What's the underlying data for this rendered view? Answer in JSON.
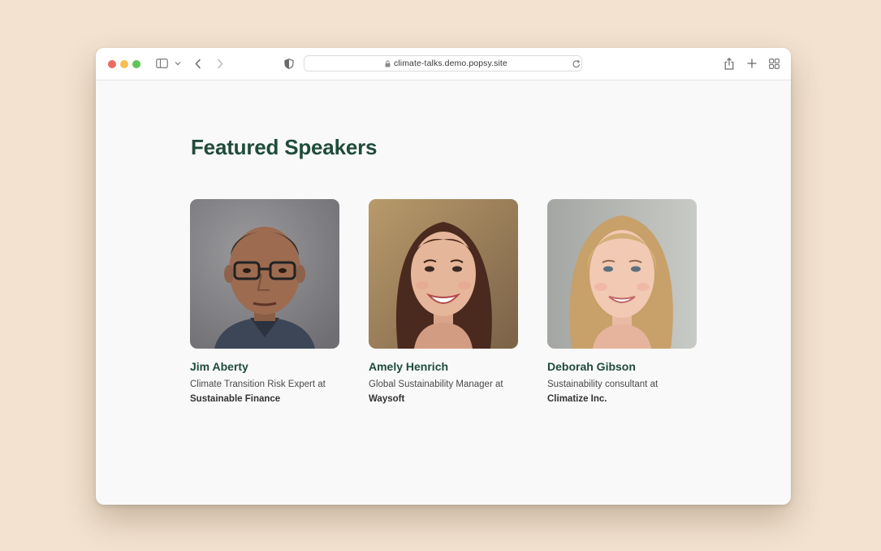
{
  "browser": {
    "url": "climate-talks.demo.popsy.site",
    "traffic_lights": {
      "close": "#ec6a5e",
      "minimize": "#f4bf4f",
      "maximize": "#61c554"
    }
  },
  "page": {
    "title": "Featured Speakers",
    "accent_color": "#1f4c3a"
  },
  "speakers": [
    {
      "name": "Jim Aberty",
      "role": "Climate Transition Risk Expert at",
      "company": "Sustainable Finance"
    },
    {
      "name": "Amely Henrich",
      "role": "Global Sustainability Manager at",
      "company": "Waysoft"
    },
    {
      "name": "Deborah Gibson",
      "role": "Sustainability consultant at",
      "company": "Climatize Inc."
    }
  ]
}
